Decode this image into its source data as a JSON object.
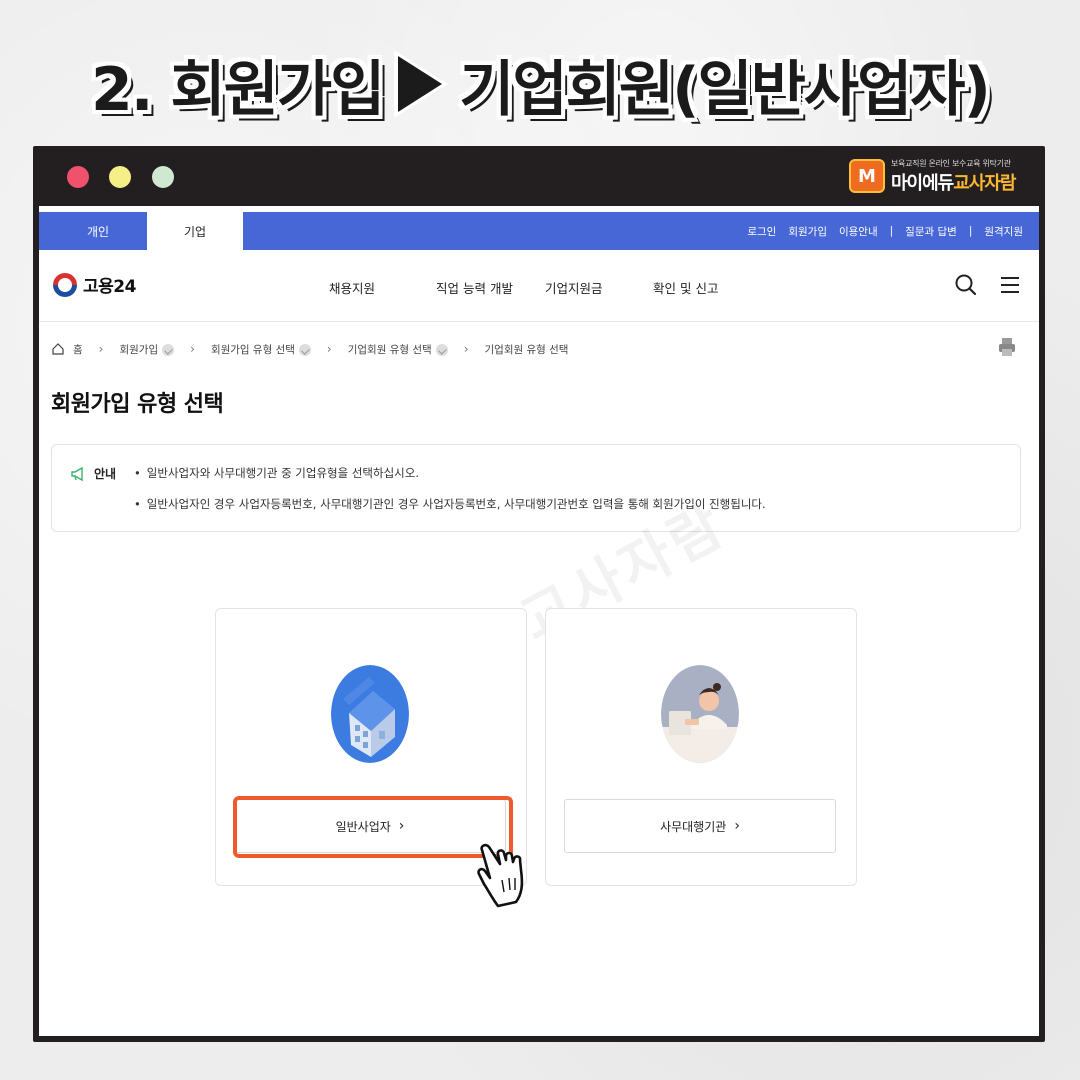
{
  "headline": {
    "step": "2. 회원가입",
    "target": "기업회원(일반사업자)"
  },
  "frame": {
    "brand_sub": "보육교직원 온라인 보수교육 위탁기관",
    "brand_main_a": "마이에듀",
    "brand_main_b": "교사자람",
    "brand_logo": "M"
  },
  "topbar": {
    "tabs": [
      "개인",
      "기업"
    ],
    "links": [
      "로그인",
      "회원가입",
      "이용안내",
      "질문과 답변",
      "원격지원"
    ],
    "sep": "|"
  },
  "nav": {
    "logo": "고용24",
    "menu": [
      "채용지원",
      "직업 능력 개발",
      "기업지원금",
      "확인 및 신고"
    ]
  },
  "breadcrumb": {
    "home": "홈",
    "items": [
      "회원가입",
      "회원가입 유형 선택",
      "기업회원 유형 선택",
      "기업회원 유형 선택"
    ],
    "sep": "›"
  },
  "page": {
    "title": "회원가입 유형 선택",
    "notice_label": "안내",
    "notice_lines": [
      "일반사업자와 사무대행기관 중 기업유형을 선택하십시오.",
      "일반사업자인 경우 사업자등록번호, 사무대행기관인 경우 사업자등록번호, 사무대행기관번호 입력을 통해 회원가입이 진행됩니다."
    ],
    "watermark": "마이에듀 교사자람"
  },
  "cards": [
    {
      "label": "일반사업자",
      "chev": "›"
    },
    {
      "label": "사무대행기관",
      "chev": "›"
    }
  ],
  "colors": {
    "topbar": "#4867d6",
    "highlight": "#ee5a2c",
    "frame": "#231f20"
  }
}
